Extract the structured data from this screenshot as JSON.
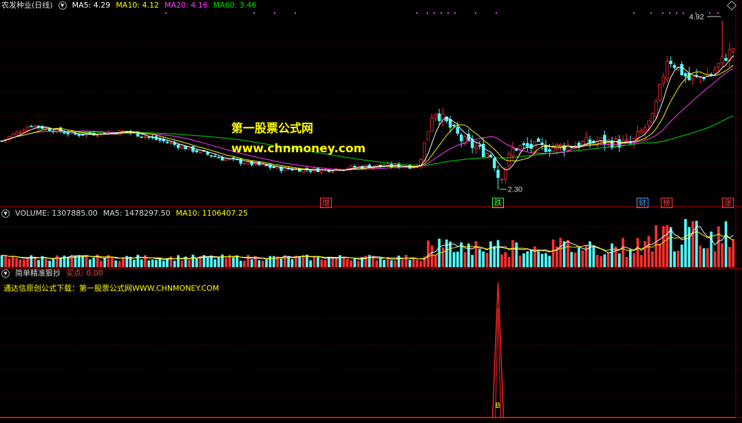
{
  "price_header": {
    "stock_title": "农发种业(日线)",
    "ma5": "MA5: 4.29",
    "ma10": "MA10: 4.12",
    "ma20": "MA20: 4.16",
    "ma60": "MA60: 3.46"
  },
  "volume_header": {
    "volume": "VOLUME: 1307885.00",
    "ma5": "MA5: 1478297.50",
    "ma10": "MA10: 1106407.25"
  },
  "indicator_header": {
    "name": "简单精准狠抄",
    "buy_label": "买点: 0.00"
  },
  "indicator_note": "通达信原创公式下载：第一股票公式网WWW.CHNMONEY.COM",
  "watermark": {
    "line1": "第一股票公式网",
    "line2": "www.chnmoney.com"
  },
  "markers": [
    {
      "text": "增",
      "color": "#ff4040"
    },
    {
      "text": "跌",
      "color": "#40ff40"
    },
    {
      "text": "财",
      "color": "#4aa0ff"
    },
    {
      "text": "榜",
      "color": "#ff4040"
    },
    {
      "text": "涨",
      "color": "#ff4040"
    }
  ],
  "colors": {
    "up": "#ff3030",
    "down": "#54ffff",
    "ma5": "#ffffff",
    "ma10": "#ffff00",
    "ma20": "#ff40ff",
    "ma60": "#00e000",
    "grid": "#800000",
    "signal": "#ff2020"
  },
  "chart_data": {
    "type": "candlestick",
    "price_high_label": "4.92",
    "price_low_label": "2.30",
    "buy_signal_label": "B",
    "y_range": [
      2.2,
      5.05
    ],
    "anchors": [
      {
        "t": 0,
        "c": 3.05
      },
      {
        "t": 0.04,
        "c": 3.3
      },
      {
        "t": 0.1,
        "c": 3.15
      },
      {
        "t": 0.17,
        "c": 3.2
      },
      {
        "t": 0.22,
        "c": 3.05
      },
      {
        "t": 0.3,
        "c": 2.78
      },
      {
        "t": 0.38,
        "c": 2.62
      },
      {
        "t": 0.44,
        "c": 2.6
      },
      {
        "t": 0.5,
        "c": 2.66
      },
      {
        "t": 0.57,
        "c": 2.66
      },
      {
        "t": 0.59,
        "c": 3.55
      },
      {
        "t": 0.63,
        "c": 3.05
      },
      {
        "t": 0.67,
        "c": 2.82
      },
      {
        "t": 0.68,
        "c": 2.45
      },
      {
        "t": 0.7,
        "c": 2.95
      },
      {
        "t": 0.76,
        "c": 2.96
      },
      {
        "t": 0.82,
        "c": 3.05
      },
      {
        "t": 0.86,
        "c": 3.0
      },
      {
        "t": 0.89,
        "c": 3.4
      },
      {
        "t": 0.91,
        "c": 4.35
      },
      {
        "t": 0.94,
        "c": 4.0
      },
      {
        "t": 0.97,
        "c": 4.1
      },
      {
        "t": 1.0,
        "c": 4.5
      }
    ]
  }
}
